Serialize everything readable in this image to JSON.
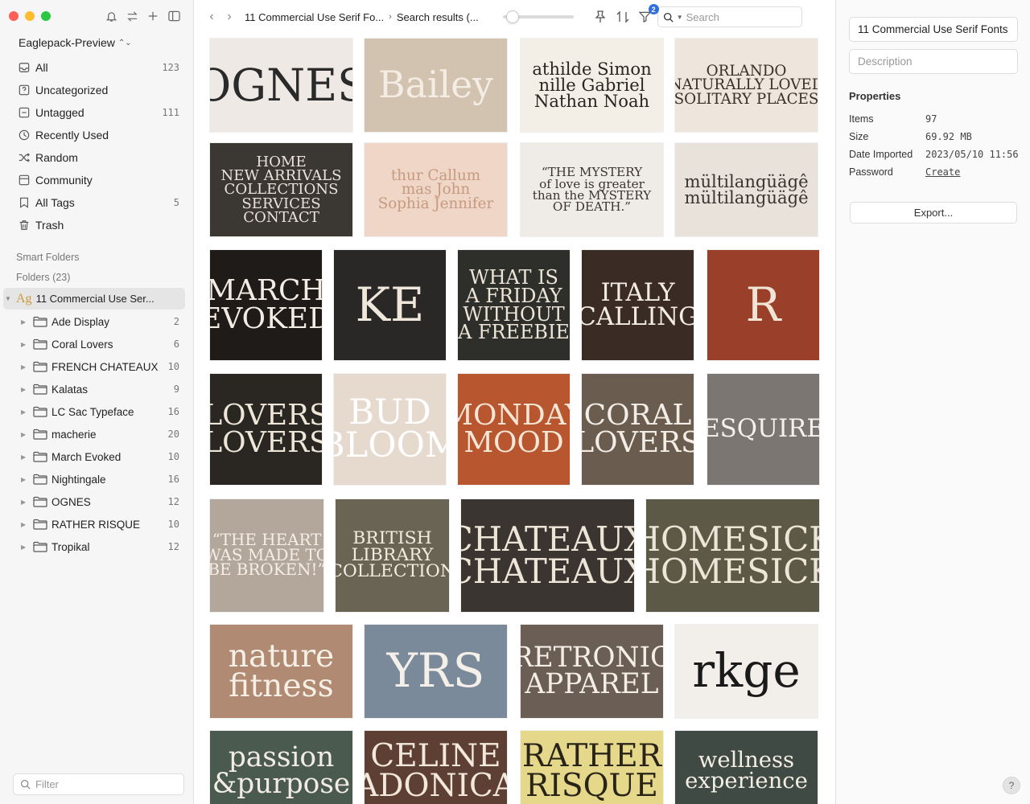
{
  "sidebar": {
    "library_name": "Eaglepack-Preview",
    "nav": [
      {
        "label": "All",
        "count": "123",
        "icon": "inbox-icon"
      },
      {
        "label": "Uncategorized",
        "count": "",
        "icon": "question-box-icon"
      },
      {
        "label": "Untagged",
        "count": "111",
        "icon": "untagged-icon"
      },
      {
        "label": "Recently Used",
        "count": "",
        "icon": "clock-icon"
      },
      {
        "label": "Random",
        "count": "",
        "icon": "shuffle-icon"
      },
      {
        "label": "Community",
        "count": "",
        "icon": "community-icon"
      },
      {
        "label": "All Tags",
        "count": "5",
        "icon": "tag-icon"
      },
      {
        "label": "Trash",
        "count": "",
        "icon": "trash-icon"
      }
    ],
    "smart_folders_label": "Smart Folders",
    "folders_label": "Folders (23)",
    "current_folder": "11 Commercial Use Ser...",
    "subfolders": [
      {
        "label": "Ade Display",
        "count": "2"
      },
      {
        "label": "Coral Lovers",
        "count": "6"
      },
      {
        "label": "FRENCH CHATEAUX",
        "count": "10"
      },
      {
        "label": "Kalatas",
        "count": "9"
      },
      {
        "label": "LC Sac Typeface",
        "count": "16"
      },
      {
        "label": "macherie",
        "count": "20"
      },
      {
        "label": "March Evoked",
        "count": "10"
      },
      {
        "label": "Nightingale",
        "count": "16"
      },
      {
        "label": "OGNES",
        "count": "12"
      },
      {
        "label": "RATHER RISQUE",
        "count": "10"
      },
      {
        "label": "Tropikal",
        "count": "12"
      }
    ],
    "filter_placeholder": "Filter"
  },
  "toolbar": {
    "breadcrumb_1": "11 Commercial Use Serif Fo...",
    "breadcrumb_2": "Search results (...",
    "filter_badge": "2",
    "search_placeholder": "Search",
    "zoom_level": 0.05
  },
  "grid": {
    "items": [
      {
        "text": "OGNES",
        "bg": "#efe9e6",
        "fg": "#2a2a2a"
      },
      {
        "text": "Bailey",
        "bg": "#d2c2b0",
        "fg": "#f4ede4"
      },
      {
        "text": "athilde Simon\nnille Gabriel\nNathan Noah",
        "bg": "#f4efe6",
        "fg": "#2a2520"
      },
      {
        "text": "ORLANDO\nNATURALLY LOVED\nSOLITARY PLACES",
        "bg": "#eee6dc",
        "fg": "#3a3028"
      },
      {
        "text": "HOME\nNEW ARRIVALS\nCOLLECTIONS\nSERVICES\nCONTACT",
        "bg": "#3b3733",
        "fg": "#e9e3da"
      },
      {
        "text": "thur Callum\nmas John\nSophia Jennifer",
        "bg": "#efd6c6",
        "fg": "#c79a82"
      },
      {
        "text": "“THE MYSTERY\nof love is greater\nthan the MYSTERY\nOF DEATH.”",
        "bg": "#efebe6",
        "fg": "#3a3530"
      },
      {
        "text": "mültilangüägê\nmültilangüägê",
        "bg": "#e8e2da",
        "fg": "#3a3430"
      },
      {
        "text": "MARCH\nEVOKED",
        "bg": "#1f1b19",
        "fg": "#f2ece4"
      },
      {
        "text": "KE",
        "bg": "#2a2826",
        "fg": "#efe7dc"
      },
      {
        "text": "WHAT IS\nA FRIDAY\nWITHOUT\nA FREEBIE",
        "bg": "#2e2f2a",
        "fg": "#ece5d8"
      },
      {
        "text": "ITALY\nCALLING",
        "bg": "#3a2c25",
        "fg": "#f3ece4"
      },
      {
        "text": "R",
        "bg": "#9a3f2a",
        "fg": "#f0e4d6"
      },
      {
        "text": "LOVERS\nLOVERS",
        "bg": "#2a2723",
        "fg": "#eee6d8"
      },
      {
        "text": "BUD\nBLOOM",
        "bg": "#e6d9cd",
        "fg": "#ffffff"
      },
      {
        "text": "MONDAY\nMOOD",
        "bg": "#b8562f",
        "fg": "#f5e6d6"
      },
      {
        "text": "CORAL\nLOVERS",
        "bg": "#6a5d50",
        "fg": "#f3ede6"
      },
      {
        "text": "ESQUIRE",
        "bg": "#7c7672",
        "fg": "#f4f0ea"
      },
      {
        "text": "“THE HEART\nWAS MADE TO\nBE BROKEN!”",
        "bg": "#b3a79c",
        "fg": "#f4eee6"
      },
      {
        "text": "BRITISH\nLIBRARY\nCOLLECTION",
        "bg": "#6a6455",
        "fg": "#f2ece0"
      },
      {
        "text": "CHATEAUX\nCHATEAUX",
        "bg": "#3a3530",
        "fg": "#ede5d8"
      },
      {
        "text": "HOMESICK\nHOMESICK",
        "bg": "#5c5a47",
        "fg": "#ece6d8"
      },
      {
        "text": "nature\nfitness",
        "bg": "#b08a72",
        "fg": "#f6efe6"
      },
      {
        "text": "YRS",
        "bg": "#7a8a9a",
        "fg": "#f4efe8"
      },
      {
        "text": "RETRONIC\nAPPAREL",
        "bg": "#6b5e54",
        "fg": "#f4eee6"
      },
      {
        "text": "rkge",
        "bg": "#f2eeea",
        "fg": "#1a1a1a"
      },
      {
        "text": "passion\n&purpose",
        "bg": "#4a5a4e",
        "fg": "#f2ece4"
      },
      {
        "text": "CELINE\nADONICA",
        "bg": "#5e3f33",
        "fg": "#f3e8dc"
      },
      {
        "text": "RATHER\nRISQUE",
        "bg": "#e6d88a",
        "fg": "#2a2418"
      },
      {
        "text": "wellness\nexperience",
        "bg": "#3f4a44",
        "fg": "#f4eee4"
      }
    ]
  },
  "inspector": {
    "title": "11 Commercial Use Serif Fonts",
    "description_placeholder": "Description",
    "properties_label": "Properties",
    "props": [
      {
        "key": "Items",
        "value": "97"
      },
      {
        "key": "Size",
        "value": "69.92 MB"
      },
      {
        "key": "Date Imported",
        "value": "2023/05/10 11:56"
      },
      {
        "key": "Password",
        "value": "Create"
      }
    ],
    "export_label": "Export...",
    "help_label": "?"
  }
}
